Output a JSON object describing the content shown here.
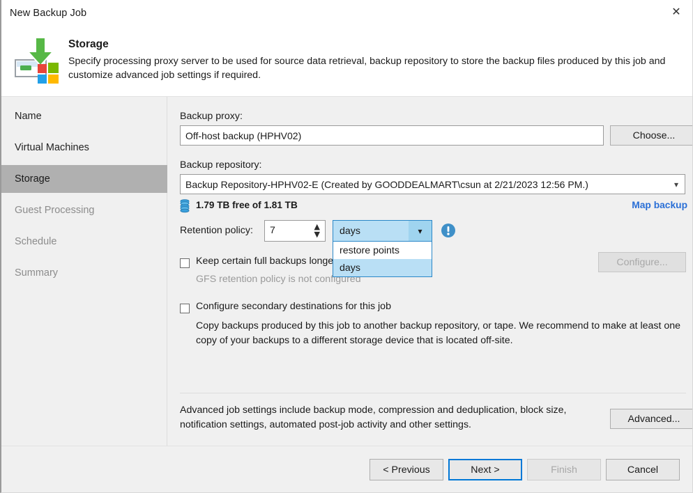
{
  "window": {
    "title": "New Backup Job",
    "close_icon": "close-icon"
  },
  "header": {
    "icon": "storage-backup-icon",
    "title": "Storage",
    "description": "Specify processing proxy server to be used for source data retrieval, backup repository to store the backup files produced by this job and customize advanced job settings if required."
  },
  "sidebar": {
    "items": [
      {
        "label": "Name",
        "state": "normal"
      },
      {
        "label": "Virtual Machines",
        "state": "normal"
      },
      {
        "label": "Storage",
        "state": "selected"
      },
      {
        "label": "Guest Processing",
        "state": "dim"
      },
      {
        "label": "Schedule",
        "state": "dim"
      },
      {
        "label": "Summary",
        "state": "dim"
      }
    ]
  },
  "main": {
    "backup_proxy": {
      "label": "Backup proxy:",
      "value": "Off-host backup (HPHV02)",
      "choose_label": "Choose..."
    },
    "backup_repository": {
      "label": "Backup repository:",
      "value": "Backup Repository-HPHV02-E (Created by GOODDEALMART\\csun at 2/21/2023 12:56 PM.)",
      "caret_icon": "chevron-down-icon"
    },
    "free_space": {
      "icon": "repository-stack-icon",
      "text": "1.79 TB free of 1.81 TB",
      "map_backup_label": "Map backup"
    },
    "retention": {
      "label": "Retention policy:",
      "value": "7",
      "spinner_up_icon": "chevron-up-icon",
      "spinner_down_icon": "chevron-down-icon",
      "units_selected": "days",
      "units_caret_icon": "chevron-down-icon",
      "units_options": [
        {
          "label": "restore points",
          "selected": false
        },
        {
          "label": "days",
          "selected": true
        }
      ],
      "warning_icon": "info-exclamation-icon"
    },
    "gfs": {
      "checkbox_label": "Keep certain full backups longer for archival purposes",
      "checked": false,
      "note": "GFS retention policy is not configured",
      "configure_label": "Configure...",
      "configure_enabled": false
    },
    "secondary": {
      "checkbox_label": "Configure secondary destinations for this job",
      "checked": false,
      "description": "Copy backups produced by this job to another backup repository, or tape. We recommend to make at least one copy of your backups to a different storage device that is located off-site."
    },
    "advanced": {
      "description": "Advanced job settings include backup mode, compression and deduplication, block size, notification settings, automated post-job activity and other settings.",
      "button_label": "Advanced..."
    }
  },
  "footer": {
    "previous_label": "< Previous",
    "next_label": "Next >",
    "finish_label": "Finish",
    "cancel_label": "Cancel"
  },
  "colors": {
    "accent": "#0078d7",
    "link": "#2a6fd6",
    "selection": "#b9dff5",
    "sidebar_selected": "#b0b0b0"
  }
}
